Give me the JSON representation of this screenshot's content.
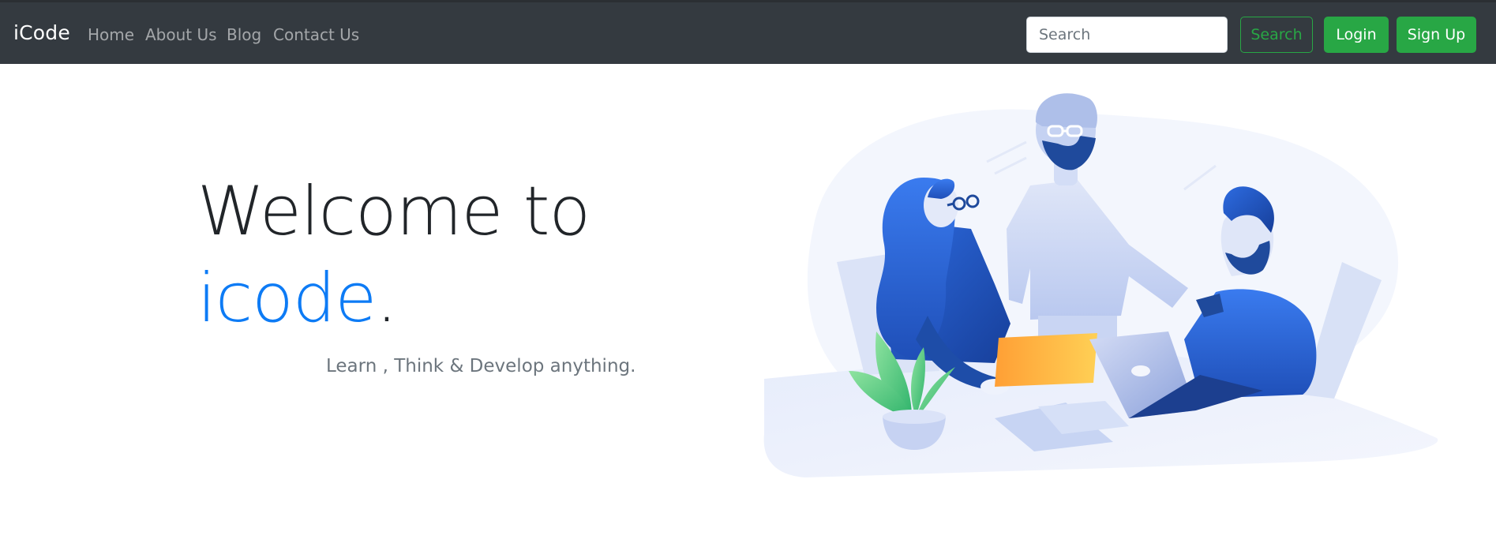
{
  "navbar": {
    "brand": "iCode",
    "links": [
      "Home",
      "About Us",
      "Blog",
      "Contact Us"
    ],
    "search": {
      "placeholder": "Search",
      "button_label": "Search"
    },
    "login_label": "Login",
    "signup_label": "Sign Up"
  },
  "hero": {
    "line1": "Welcome to",
    "brand_word": "icode",
    "period": ".",
    "tagline": "Learn , Think & Develop anything."
  },
  "colors": {
    "navbar_bg": "#343a40",
    "accent_blue": "#0d7bf5",
    "success_green": "#28a745"
  },
  "illustration": {
    "icons": [
      "team-meeting-illustration",
      "laptop-icon",
      "plant-icon",
      "folder-icon"
    ]
  }
}
